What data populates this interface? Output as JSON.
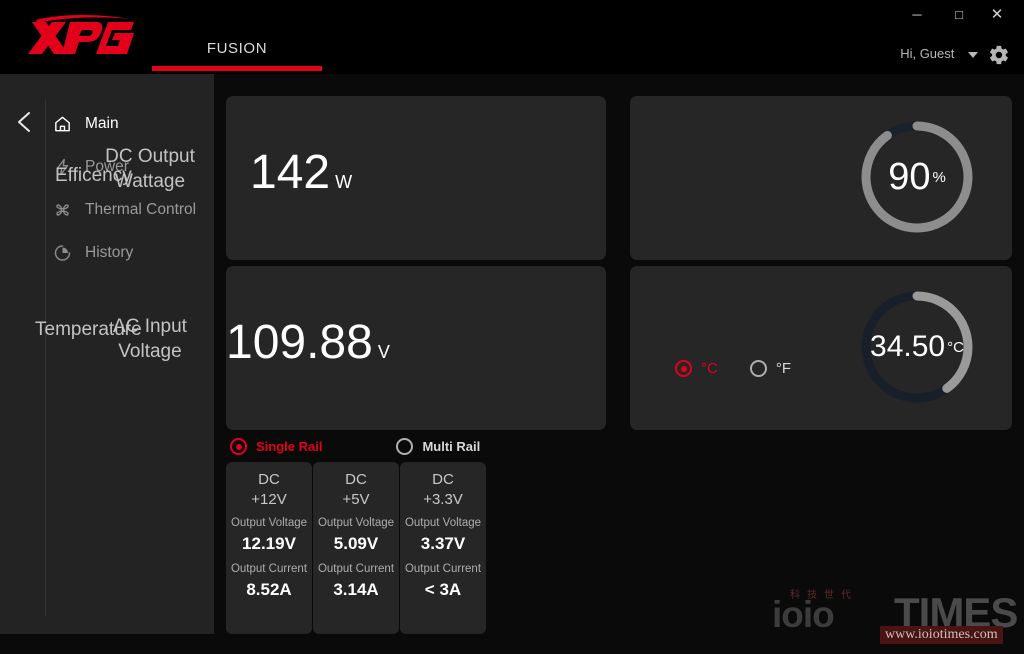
{
  "window": {
    "minimize_label": "─",
    "maximize_label": "□",
    "close_label": "✕"
  },
  "header": {
    "brand": "XPG",
    "tab_label": "FUSION",
    "user_label": "Hi, Guest",
    "settings_icon": "gear-icon"
  },
  "sidebar": {
    "back_icon": "chevron-left-icon",
    "items": [
      {
        "label": "Main",
        "icon": "home-icon",
        "active": true
      },
      {
        "label": "Power",
        "icon": "bolt-icon",
        "active": false
      },
      {
        "label": "Thermal Control",
        "icon": "fan-icon",
        "active": false
      },
      {
        "label": "History",
        "icon": "clock-icon",
        "active": false
      }
    ]
  },
  "main": {
    "wattage": {
      "label_line1": "DC Output",
      "label_line2": "Wattage",
      "value": "142",
      "unit": "W"
    },
    "ac_input": {
      "label_line1": "AC Input",
      "label_line2": "Voltage",
      "value": "109.88",
      "unit": "V"
    },
    "efficiency": {
      "label": "Efficency",
      "value": "90",
      "unit": "%",
      "gauge_percent": 90,
      "gauge_fill_color": "#8d8d8d",
      "gauge_track_color": "#1b212c"
    },
    "temperature": {
      "label": "Temperature",
      "value": "34.50",
      "unit": "°C",
      "gauge_percent": 40,
      "gauge_fill_color": "#9a9a9a",
      "gauge_track_color": "#191f29",
      "units": [
        {
          "label": "°C",
          "selected": true
        },
        {
          "label": "°F",
          "selected": false
        }
      ]
    },
    "rail_mode": [
      {
        "label": "Single Rail",
        "selected": true
      },
      {
        "label": "Multi Rail",
        "selected": false
      }
    ],
    "rails": [
      {
        "dc": "DC",
        "name": "+12V",
        "voltage_caption": "Output Voltage",
        "voltage": "12.19V",
        "current_caption": "Output Current",
        "current": "8.52A"
      },
      {
        "dc": "DC",
        "name": "+5V",
        "voltage_caption": "Output Voltage",
        "voltage": "5.09V",
        "current_caption": "Output Current",
        "current": "3.14A"
      },
      {
        "dc": "DC",
        "name": "+3.3V",
        "voltage_caption": "Output Voltage",
        "voltage": "3.37V",
        "current_caption": "Output Current",
        "current": "< 3A"
      }
    ]
  },
  "watermark": {
    "cn": "科技世代",
    "ioio": "ioio",
    "times": "TIMES",
    "url": "www.ioiotimes.com"
  },
  "colors": {
    "accent": "#e2001a",
    "card_bg": "#262626",
    "sidebar_bg": "#232323",
    "app_bg": "#0a0a0a"
  }
}
